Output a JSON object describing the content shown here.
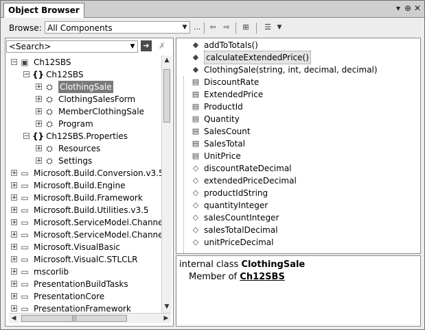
{
  "window": {
    "tab_title": "Object Browser",
    "tab_buttons": {
      "dropdown": "▾",
      "pin": "⊕",
      "close": "✕"
    }
  },
  "toolbar": {
    "browse_label": "Browse:",
    "browse_value": "All Components",
    "dots_label": "...",
    "back_icon": "back-arrow-icon",
    "forward_icon": "forward-arrow-icon",
    "add_reference_icon": "add-reference-icon",
    "settings_icon": "settings-icon"
  },
  "search": {
    "placeholder": "<Search>"
  },
  "tree": {
    "items": [
      {
        "label": "Ch12SBS",
        "icon": "project-icon",
        "expander": "−"
      },
      {
        "label": "Ch12SBS",
        "icon": "namespace-icon",
        "expander": "−"
      },
      {
        "label": "ClothingSale",
        "icon": "class-icon",
        "expander": "+",
        "selected": true
      },
      {
        "label": "ClothingSalesForm",
        "icon": "class-icon",
        "expander": "+"
      },
      {
        "label": "MemberClothingSale",
        "icon": "class-icon",
        "expander": "+"
      },
      {
        "label": "Program",
        "icon": "class-icon",
        "expander": "+"
      },
      {
        "label": "Ch12SBS.Properties",
        "icon": "namespace-icon",
        "expander": "−"
      },
      {
        "label": "Resources",
        "icon": "class-icon",
        "expander": "+"
      },
      {
        "label": "Settings",
        "icon": "class-icon",
        "expander": "+"
      },
      {
        "label": "Microsoft.Build.Conversion.v3.5",
        "icon": "assembly-icon",
        "expander": "+"
      },
      {
        "label": "Microsoft.Build.Engine",
        "icon": "assembly-icon",
        "expander": "+"
      },
      {
        "label": "Microsoft.Build.Framework",
        "icon": "assembly-icon",
        "expander": "+"
      },
      {
        "label": "Microsoft.Build.Utilities.v3.5",
        "icon": "assembly-icon",
        "expander": "+"
      },
      {
        "label": "Microsoft.ServiceModel.Channels.",
        "icon": "assembly-icon",
        "expander": "+"
      },
      {
        "label": "Microsoft.ServiceModel.Channels.",
        "icon": "assembly-icon",
        "expander": "+"
      },
      {
        "label": "Microsoft.VisualBasic",
        "icon": "assembly-icon",
        "expander": "+"
      },
      {
        "label": "Microsoft.VisualC.STLCLR",
        "icon": "assembly-icon",
        "expander": "+"
      },
      {
        "label": "mscorlib",
        "icon": "assembly-icon",
        "expander": "+"
      },
      {
        "label": "PresentationBuildTasks",
        "icon": "assembly-icon",
        "expander": "+"
      },
      {
        "label": "PresentationCore",
        "icon": "assembly-icon",
        "expander": "+"
      },
      {
        "label": "PresentationFramework",
        "icon": "assembly-icon",
        "expander": "+"
      }
    ]
  },
  "members": {
    "items": [
      {
        "label": "addToTotals()",
        "icon": "method-icon"
      },
      {
        "label": "calculateExtendedPrice()",
        "icon": "method-icon",
        "selected": true
      },
      {
        "label": "ClothingSale(string, int, decimal, decimal)",
        "icon": "method-icon"
      },
      {
        "label": "DiscountRate",
        "icon": "property-icon"
      },
      {
        "label": "ExtendedPrice",
        "icon": "property-icon"
      },
      {
        "label": "ProductId",
        "icon": "property-icon"
      },
      {
        "label": "Quantity",
        "icon": "property-icon"
      },
      {
        "label": "SalesCount",
        "icon": "property-icon"
      },
      {
        "label": "SalesTotal",
        "icon": "property-icon"
      },
      {
        "label": "UnitPrice",
        "icon": "property-icon"
      },
      {
        "label": "discountRateDecimal",
        "icon": "field-icon"
      },
      {
        "label": "extendedPriceDecimal",
        "icon": "field-icon"
      },
      {
        "label": "productIdString",
        "icon": "field-icon"
      },
      {
        "label": "quantityInteger",
        "icon": "field-icon"
      },
      {
        "label": "salesCountInteger",
        "icon": "field-icon"
      },
      {
        "label": "salesTotalDecimal",
        "icon": "field-icon"
      },
      {
        "label": "unitPriceDecimal",
        "icon": "field-icon"
      }
    ]
  },
  "description": {
    "prefix": "internal class ",
    "class_name": "ClothingSale",
    "member_of": "Member of ",
    "parent_link": "Ch12SBS"
  }
}
